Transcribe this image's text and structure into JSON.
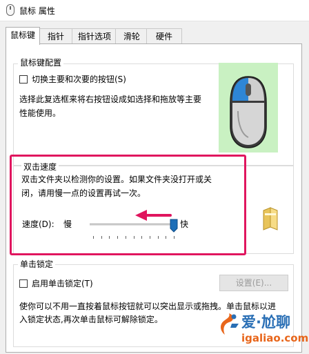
{
  "window": {
    "title": "鼠标 属性"
  },
  "tabs": [
    {
      "label": "鼠标键",
      "active": true
    },
    {
      "label": "指针"
    },
    {
      "label": "指针选项"
    },
    {
      "label": "滑轮"
    },
    {
      "label": "硬件"
    }
  ],
  "button_config": {
    "legend": "鼠标键配置",
    "switch_label": "切换主要和次要的按钮(S)",
    "switch_checked": false,
    "description_line1": "选择此复选框来将右按钮设成如选择和拖放等主要",
    "description_line2": "性能使用。"
  },
  "double_click": {
    "legend": "双击速度",
    "description_line1": "双击文件夹以检测你的设置。如果文件夹没打开或关",
    "description_line2": "闭，请用慢一点的设置再试一次。",
    "speed_label": "速度(D):",
    "slow_label": "慢",
    "fast_label": "快",
    "speed_level": 1.0
  },
  "click_lock": {
    "legend": "单击锁定",
    "enable_label": "启用单击锁定(T)",
    "enable_checked": false,
    "settings_button": "设置(E)...",
    "description_line1": "使你可以不用一直按着鼠标按钮就可以突出显示或拖拽。单击鼠标以进",
    "description_line2": "入锁定状态,再次单击鼠标可解除锁定。"
  },
  "watermark": {
    "brand": "爱·尬聊",
    "site": "igaliao.com"
  },
  "colors": {
    "highlight": "#e0155e",
    "arrow": "#e0155e",
    "mouse_bg": "#c9f1c2",
    "slider_thumb": "#1e6fb8",
    "mouse_button_blue": "#2e86d6"
  }
}
